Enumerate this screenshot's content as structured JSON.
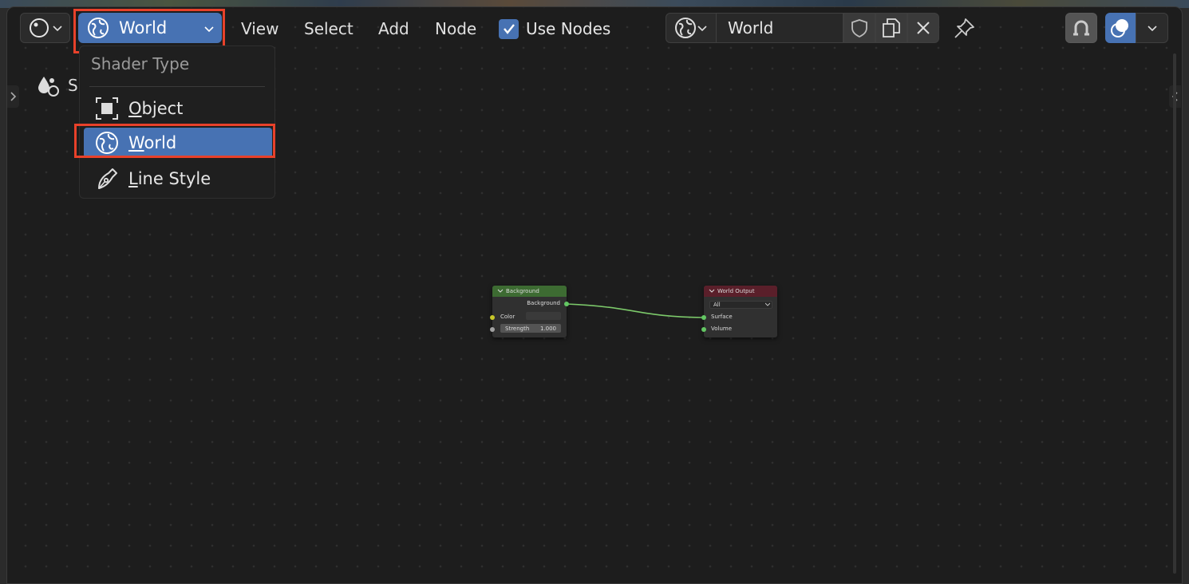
{
  "header": {
    "editor_type_icon": "node-editor-icon",
    "shader_type_button": {
      "icon": "world-icon",
      "label": "World"
    },
    "menus": [
      "View",
      "Select",
      "Add",
      "Node"
    ],
    "use_nodes": {
      "label": "Use Nodes",
      "checked": true
    },
    "datablock": {
      "icon": "world-icon",
      "name": "World"
    },
    "right_icons": [
      "fake-user-shield-icon",
      "duplicate-icon",
      "unlink-icon",
      "pin-icon",
      "snap-icon",
      "overlay-icon"
    ]
  },
  "sidebar": {
    "tool_icon": "tool-drops-icon",
    "label_initial": "S"
  },
  "dropdown": {
    "title": "Shader Type",
    "items": [
      {
        "icon": "object-icon",
        "label": "Object",
        "underline": "O",
        "rest": "bject"
      },
      {
        "icon": "world-icon",
        "label": "World",
        "underline": "W",
        "rest": "orld",
        "selected": true
      },
      {
        "icon": "line-style-icon",
        "label": "Line Style",
        "underline": "L",
        "rest": "ine Style"
      }
    ]
  },
  "nodes": {
    "background": {
      "title": "Background",
      "output": "Background",
      "inputs": {
        "color": "Color",
        "strength_label": "Strength",
        "strength_value": "1.000"
      }
    },
    "world_output": {
      "title": "World Output",
      "target": "All",
      "inputs": {
        "surface": "Surface",
        "volume": "Volume"
      }
    }
  },
  "colors": {
    "accent": "#4772b3",
    "highlight": "#e8412a",
    "background_node_header": "#3d6b32",
    "output_node_header": "#5a1f2a",
    "link": "#7cc96a"
  }
}
